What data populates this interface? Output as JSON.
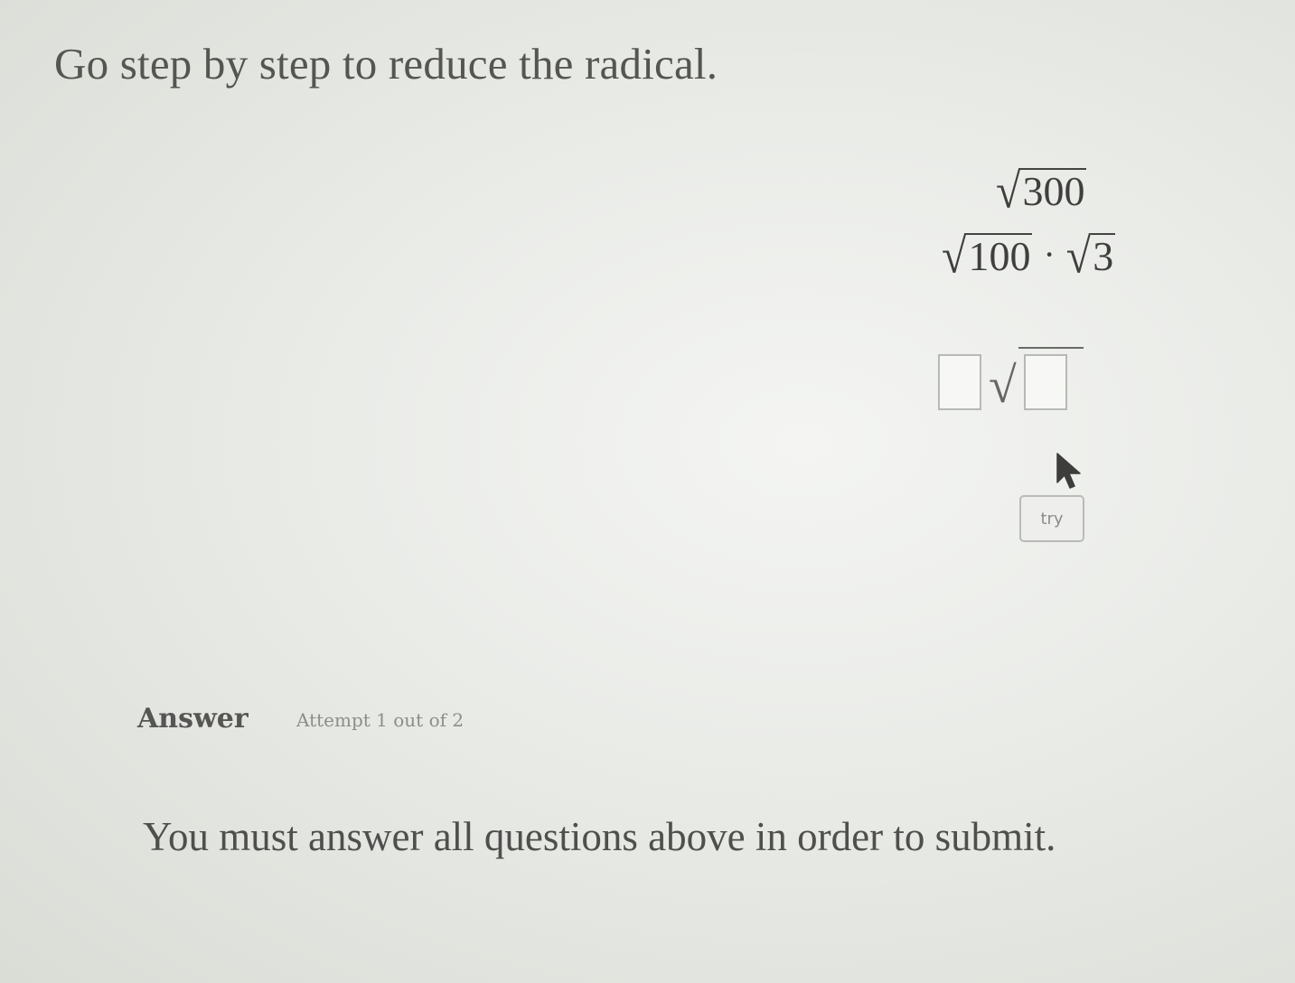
{
  "question": {
    "title": "Go step by step to reduce the radical."
  },
  "steps": {
    "step1": {
      "radicand": "300"
    },
    "step2": {
      "radicand_a": "100",
      "operator": "·",
      "radicand_b": "3"
    }
  },
  "answer_input": {
    "coefficient_value": "",
    "radicand_value": ""
  },
  "try_button": {
    "label": "try"
  },
  "answer_section": {
    "label": "Answer",
    "attempt_text": "Attempt 1 out of 2"
  },
  "notice": "You must answer all questions above in order to submit.",
  "icons": {
    "cursor": "mouse-pointer-icon"
  }
}
